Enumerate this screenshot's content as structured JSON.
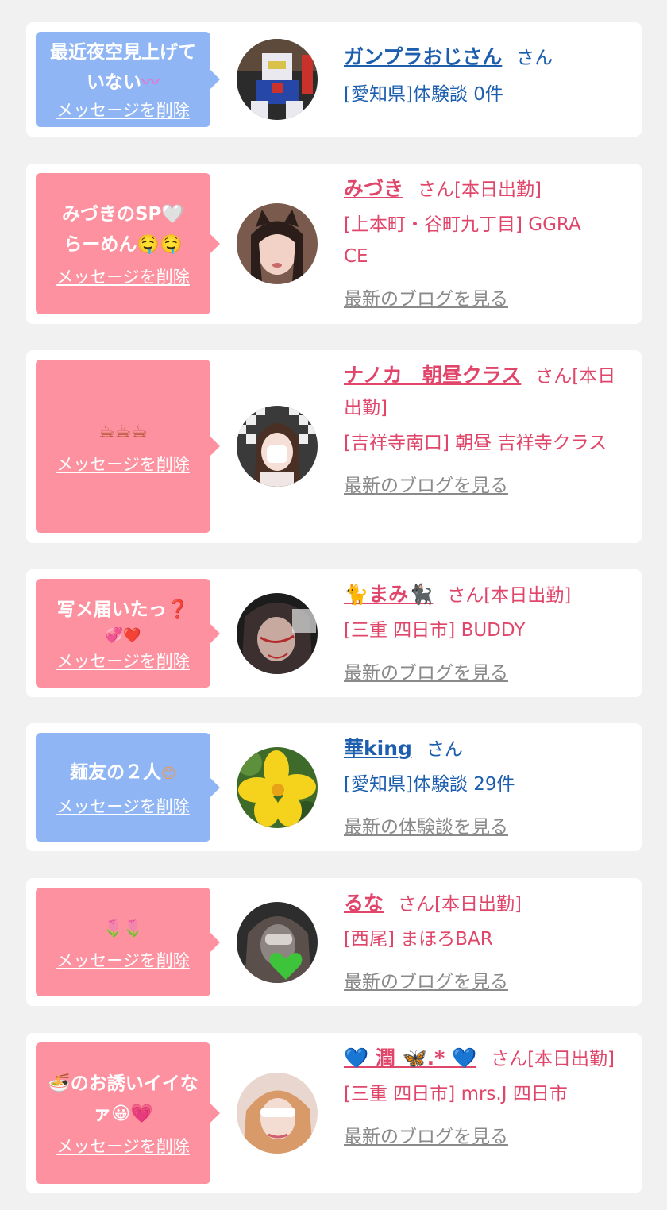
{
  "delete_label": "メッセージを削除",
  "cards": [
    {
      "message": "最近夜空見上げていない",
      "message_emoji": "〰",
      "name": "ガンプラおじさん",
      "suffix": "さん",
      "detail": "[愛知県]体験談 0件",
      "link": ""
    },
    {
      "message": "みづきのSP🤍らーめん🤤🤤",
      "message_emoji": "",
      "name": "みづき",
      "suffix": "さん[本日出勤]",
      "detail": "[上本町・谷町九丁目] GGRACE",
      "link": "最新のブログを見る"
    },
    {
      "message": "☕☕☕",
      "message_emoji": "",
      "name": "ナノカ　朝昼クラス",
      "suffix": "さん[本日出勤]",
      "detail": "[吉祥寺南口] 朝昼 吉祥寺クラス",
      "link": "最新のブログを見る"
    },
    {
      "message": "写メ届いたっ❓",
      "message_emoji": "💞❤️",
      "name": "🐈まみ🐈‍⬛",
      "suffix": "さん[本日出勤]",
      "detail": "[三重 四日市] BUDDY",
      "link": "最新のブログを見る"
    },
    {
      "message": "麺友の２人",
      "message_emoji": "😊",
      "name": "華king",
      "suffix": "さん",
      "detail": "[愛知県]体験談 29件",
      "link": "最新の体験談を見る"
    },
    {
      "message": "🌷🌷",
      "message_emoji": "",
      "name": "るな",
      "suffix": "さん[本日出勤]",
      "detail": "[西尾] まほろBAR",
      "link": "最新のブログを見る"
    },
    {
      "message": "🍜のお誘いイイなァ😀💗",
      "message_emoji": "",
      "name": "💙 潤 🦋.* 💙",
      "suffix": "さん[本日出勤]",
      "detail": "[三重 四日市] mrs.J 四日市",
      "link": "最新のブログを見る"
    }
  ]
}
